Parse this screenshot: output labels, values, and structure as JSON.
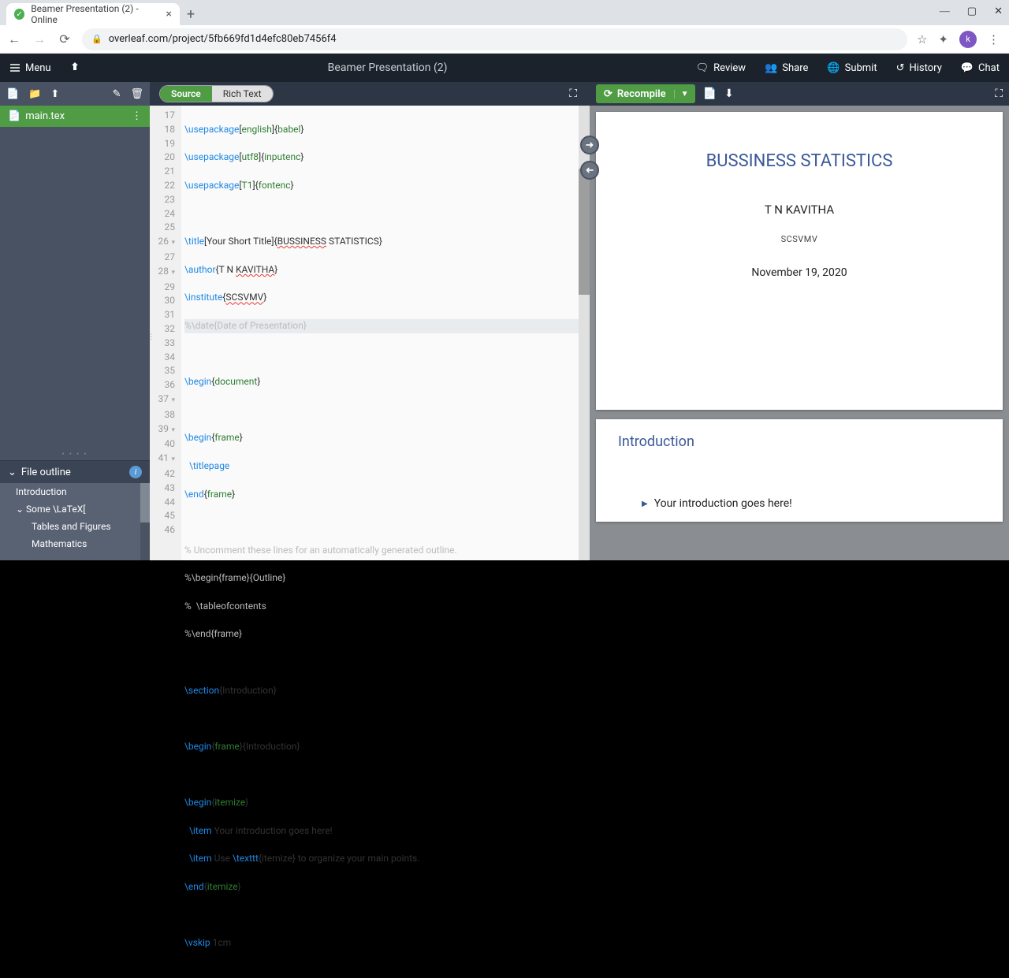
{
  "browser": {
    "tab_title": "Beamer Presentation (2) - Online",
    "url": "overleaf.com/project/5fb669fd1d4efc80eb7456f4"
  },
  "topbar": {
    "menu": "Menu",
    "title": "Beamer Presentation (2)",
    "review": "Review",
    "share": "Share",
    "submit": "Submit",
    "history": "History",
    "chat": "Chat"
  },
  "toggle": {
    "source": "Source",
    "rich": "Rich Text"
  },
  "recompile": "Recompile",
  "filetree": {
    "file": "main.tex"
  },
  "outline": {
    "header": "File outline",
    "items": [
      "Introduction",
      "Some \\LaTeX[",
      "Tables and Figures",
      "Mathematics"
    ]
  },
  "gutter": [
    "17",
    "18",
    "19",
    "20",
    "21",
    "22",
    "23",
    "24",
    "25",
    "26",
    "27",
    "28",
    "29",
    "30",
    "31",
    "32",
    "33",
    "34",
    "35",
    "36",
    "37",
    "38",
    "39",
    "40",
    "41",
    "42",
    "43",
    "44",
    "45",
    "46"
  ],
  "code": {
    "l17a": "\\usepackage",
    "l17b": "english",
    "l17c": "babel",
    "l18a": "\\usepackage",
    "l18b": "utf8",
    "l18c": "inputenc",
    "l19a": "\\usepackage",
    "l19b": "T1",
    "l19c": "fontenc",
    "l21a": "\\title",
    "l21b": "[Your Short Title]{",
    "l21c": "BUSSINESS",
    "l21d": " STATISTICS}",
    "l22a": "\\author",
    "l22b": "{T N ",
    "l22c": "KAVITHA",
    "l22d": "}",
    "l23a": "\\institute",
    "l23b": "{",
    "l23c": "SCSVMV",
    "l23d": "}",
    "l24": "%\\date{Date of Presentation}",
    "l26a": "\\begin",
    "l26b": "document",
    "l28a": "\\begin",
    "l28b": "frame",
    "l29": "  \\titlepage",
    "l30a": "\\end",
    "l30b": "frame",
    "l32": "% Uncomment these lines for an automatically generated outline.",
    "l33": "%\\begin{frame}{Outline}",
    "l34": "%  \\tableofcontents",
    "l35": "%\\end{frame}",
    "l37a": "\\section",
    "l37b": "{Introduction}",
    "l39a": "\\begin",
    "l39b": "frame",
    "l39c": "{Introduction}",
    "l41a": "\\begin",
    "l41b": "itemize",
    "l42a": "  \\item",
    "l42b": " Your introduction goes here!",
    "l43a": "  \\item",
    "l43b": " Use ",
    "l43c": "\\texttt",
    "l43d": "{itemize}",
    "l43e": " to organize your main points.",
    "l44a": "\\end",
    "l44b": "itemize",
    "l46a": "\\vskip",
    "l46b": " 1cm"
  },
  "pdf": {
    "title": "BUSSINESS STATISTICS",
    "author": "T N KAVITHA",
    "institute": "SCSVMV",
    "date": "November 19, 2020",
    "section": "Introduction",
    "bullet1": "Your introduction goes here!"
  }
}
